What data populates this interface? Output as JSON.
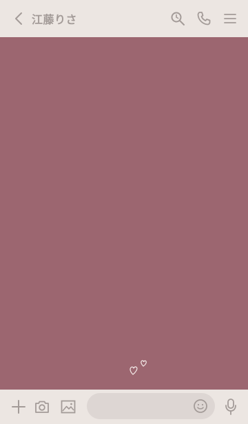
{
  "header": {
    "title": "江藤りさ",
    "back_icon": "chevron-left-icon",
    "actions": [
      {
        "icon": "search-icon"
      },
      {
        "icon": "phone-icon"
      },
      {
        "icon": "menu-icon"
      }
    ]
  },
  "chat": {
    "background_color": "#9c6670",
    "decoration_icon": "hearts-icon"
  },
  "footer": {
    "add_icon": "plus-icon",
    "camera_icon": "camera-icon",
    "image_icon": "image-icon",
    "input_placeholder": "",
    "emoji_icon": "emoji-icon",
    "mic_icon": "microphone-icon"
  },
  "colors": {
    "header_bg": "#ece6e2",
    "icon": "#a39b98",
    "accent": "#9c6670",
    "input_bg": "#ddd6d3"
  }
}
